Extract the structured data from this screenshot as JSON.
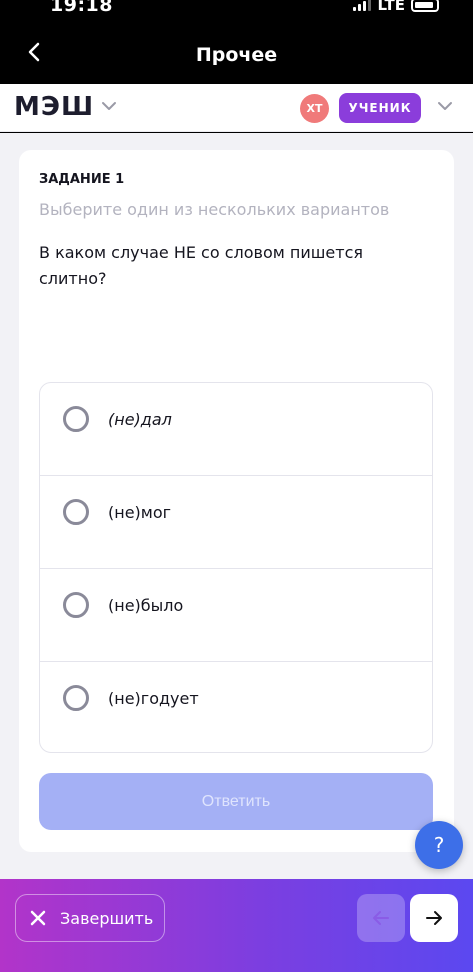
{
  "status": {
    "time": "19:18",
    "network": "LTE"
  },
  "nav": {
    "title": "Прочее"
  },
  "header": {
    "logo": "МЭШ",
    "avatar_initials": "ХТ",
    "role": "УЧЕНИК"
  },
  "task": {
    "label": "ЗАДАНИЕ 1",
    "hint": "Выберите один из нескольких вариантов",
    "question": "В каком случае НЕ со словом пишется слитно?",
    "options": [
      {
        "text": "(не)дал"
      },
      {
        "text": "(не)мог"
      },
      {
        "text": "(не)было"
      },
      {
        "text": "(не)годует"
      }
    ],
    "submit_label": "Ответить"
  },
  "help": {
    "label": "?"
  },
  "footer": {
    "finish_label": "Завершить"
  },
  "colors": {
    "accent": "#8b3ddb",
    "submit_disabled": "#a4b0f5",
    "help": "#3d6fe8"
  }
}
